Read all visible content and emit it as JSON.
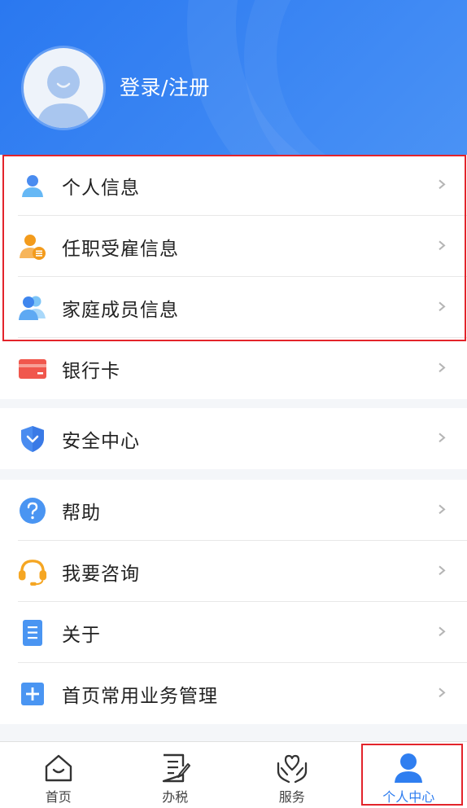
{
  "header": {
    "login_label": "登录/注册"
  },
  "groups": [
    {
      "items": [
        {
          "label": "个人信息",
          "icon": "person-icon"
        },
        {
          "label": "任职受雇信息",
          "icon": "employee-icon"
        },
        {
          "label": "家庭成员信息",
          "icon": "family-icon"
        },
        {
          "label": "银行卡",
          "icon": "bank-card-icon"
        }
      ]
    },
    {
      "items": [
        {
          "label": "安全中心",
          "icon": "shield-icon"
        }
      ]
    },
    {
      "items": [
        {
          "label": "帮助",
          "icon": "question-icon"
        },
        {
          "label": "我要咨询",
          "icon": "headset-icon"
        },
        {
          "label": "关于",
          "icon": "document-icon"
        },
        {
          "label": "首页常用业务管理",
          "icon": "plus-square-icon"
        }
      ]
    }
  ],
  "tabbar": {
    "tabs": [
      {
        "label": "首页",
        "icon": "home-icon",
        "active": false
      },
      {
        "label": "办税",
        "icon": "tax-form-icon",
        "active": false
      },
      {
        "label": "服务",
        "icon": "heart-hands-icon",
        "active": false
      },
      {
        "label": "个人中心",
        "icon": "user-center-icon",
        "active": true
      }
    ]
  },
  "colors": {
    "header_blue": "#2a78f0",
    "active_tab": "#2f7ef0",
    "highlight_red": "#e3242b"
  }
}
